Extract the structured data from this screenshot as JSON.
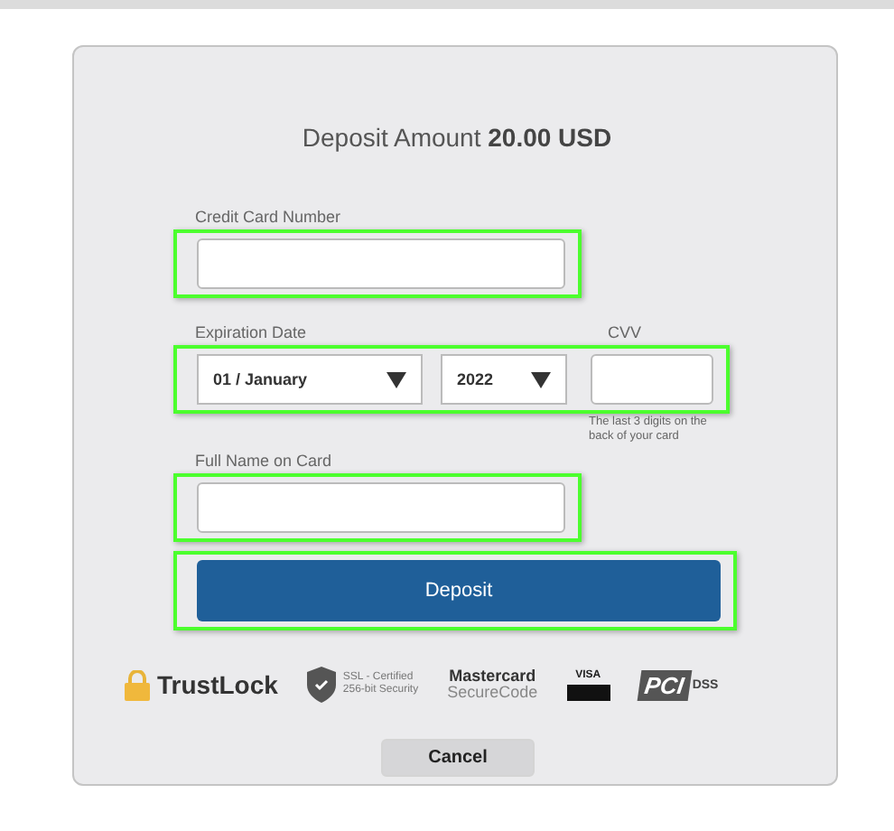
{
  "title": {
    "text": "Deposit Amount ",
    "amount": "20.00 USD"
  },
  "card_number": {
    "label": "Credit Card Number",
    "highlighted": true
  },
  "expiration": {
    "label": "Expiration Date",
    "month": "01 / January",
    "year": "2022",
    "highlighted": true
  },
  "cvv": {
    "label": "CVV",
    "hint": "The last 3 digits on the back of your card"
  },
  "full_name": {
    "label": "Full Name on Card",
    "highlighted": true
  },
  "deposit_button": {
    "label": "Deposit",
    "highlighted": true
  },
  "badges": [
    {
      "kind": "trustlock",
      "texts": [
        "TrustLock"
      ]
    },
    {
      "kind": "ssl",
      "texts": [
        "SSL - Certified",
        "256-bit Security"
      ]
    },
    {
      "kind": "mastercard",
      "texts": [
        "Mastercard",
        "SecureCode"
      ]
    },
    {
      "kind": "visa",
      "texts": [
        "VISA"
      ]
    },
    {
      "kind": "pci",
      "texts": [
        "PCI",
        "DSS"
      ]
    }
  ],
  "cancel_button": {
    "label": "Cancel"
  }
}
